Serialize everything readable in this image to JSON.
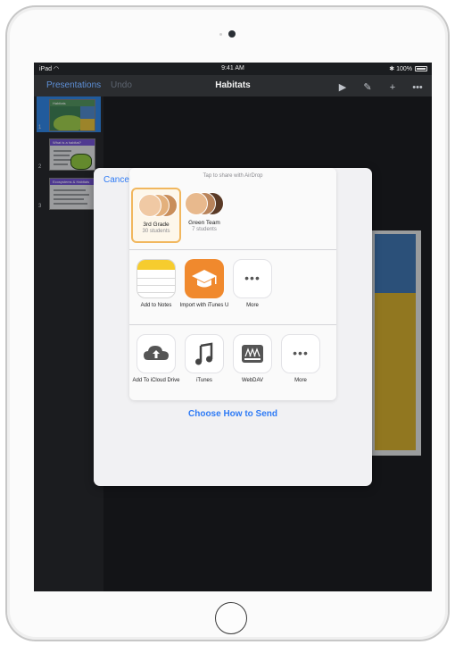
{
  "status": {
    "carrier": "iPad",
    "time": "9:41 AM",
    "battery": "100%"
  },
  "navbar": {
    "back_label": "Presentations",
    "undo_label": "Undo",
    "title": "Habitats"
  },
  "slides": [
    {
      "number": "1",
      "title": "Habitats"
    },
    {
      "number": "2",
      "title": "What is a habitat?"
    },
    {
      "number": "3",
      "title": "Ecosystems & Habitats"
    }
  ],
  "share": {
    "cancel_label": "Cancel",
    "airdrop_hint": "Tap to share with AirDrop",
    "people": [
      {
        "name": "3rd Grade",
        "sub": "30 students"
      },
      {
        "name": "Green Team",
        "sub": "7 students"
      }
    ],
    "share_apps": [
      {
        "label": "Add to Notes",
        "icon": "notes-icon"
      },
      {
        "label": "Import with iTunes U",
        "icon": "graduation-cap-icon"
      },
      {
        "label": "More",
        "icon": "more-dots-icon"
      }
    ],
    "action_apps": [
      {
        "label": "Add To iCloud Drive",
        "icon": "icloud-upload-icon"
      },
      {
        "label": "iTunes",
        "icon": "music-note-icon"
      },
      {
        "label": "WebDAV",
        "icon": "webdav-icon"
      },
      {
        "label": "More",
        "icon": "more-dots-icon"
      }
    ],
    "choose_label": "Choose How to Send"
  },
  "colors": {
    "accent": "#2f7bf5",
    "selection": "#f1b75e",
    "sidebar_selection": "#2f7ed8"
  }
}
